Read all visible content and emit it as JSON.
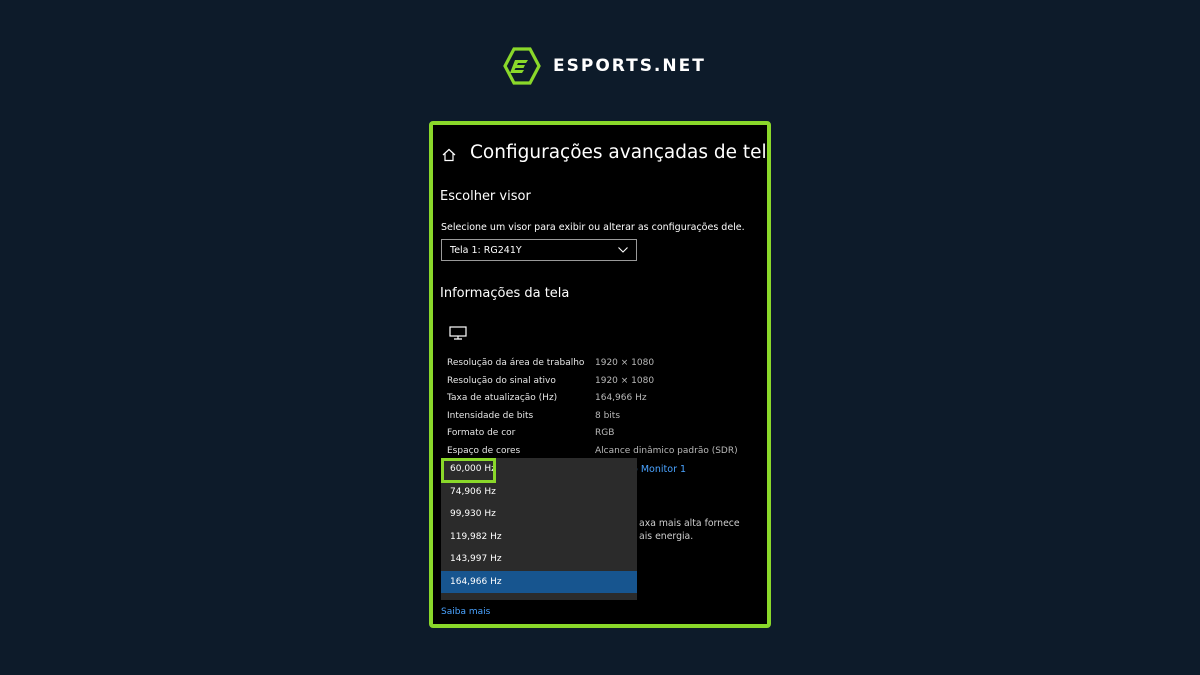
{
  "brand": {
    "name": "ESPORTS.NET"
  },
  "window": {
    "title": "Configurações avançadas de tela",
    "home_icon": "home-icon",
    "choose_display": {
      "heading": "Escolher visor",
      "description": "Selecione um visor para exibir ou alterar as configurações dele.",
      "selected": "Tela 1: RG241Y"
    },
    "display_info": {
      "heading": "Informações da tela",
      "monitor_icon": "monitor-icon",
      "rows": [
        {
          "label": "Resolução da área de trabalho",
          "value": "1920 × 1080"
        },
        {
          "label": "Resolução do sinal ativo",
          "value": "1920 × 1080"
        },
        {
          "label": "Taxa de atualização (Hz)",
          "value": "164,966 Hz"
        },
        {
          "label": "Intensidade de bits",
          "value": "8 bits"
        },
        {
          "label": "Formato de cor",
          "value": "RGB"
        },
        {
          "label": "Espaço de cores",
          "value": "Alcance dinâmico padrão (SDR)"
        }
      ],
      "adapter_link_partial": "do Monitor 1"
    },
    "refresh_desc_partial": [
      "axa mais alta fornece",
      "ais energia."
    ],
    "learn_more": "Saiba mais",
    "refresh_dropdown": {
      "options": [
        "60,000 Hz",
        "74,906 Hz",
        "99,930 Hz",
        "119,982 Hz",
        "143,997 Hz",
        "164,966 Hz"
      ],
      "selected_index": 5,
      "highlighted_option": "60,000 Hz"
    }
  },
  "colors": {
    "background": "#0d1b2a",
    "accent_green": "#8ad82a",
    "selection_blue": "#17558f",
    "link_blue": "#4aa3ff"
  }
}
